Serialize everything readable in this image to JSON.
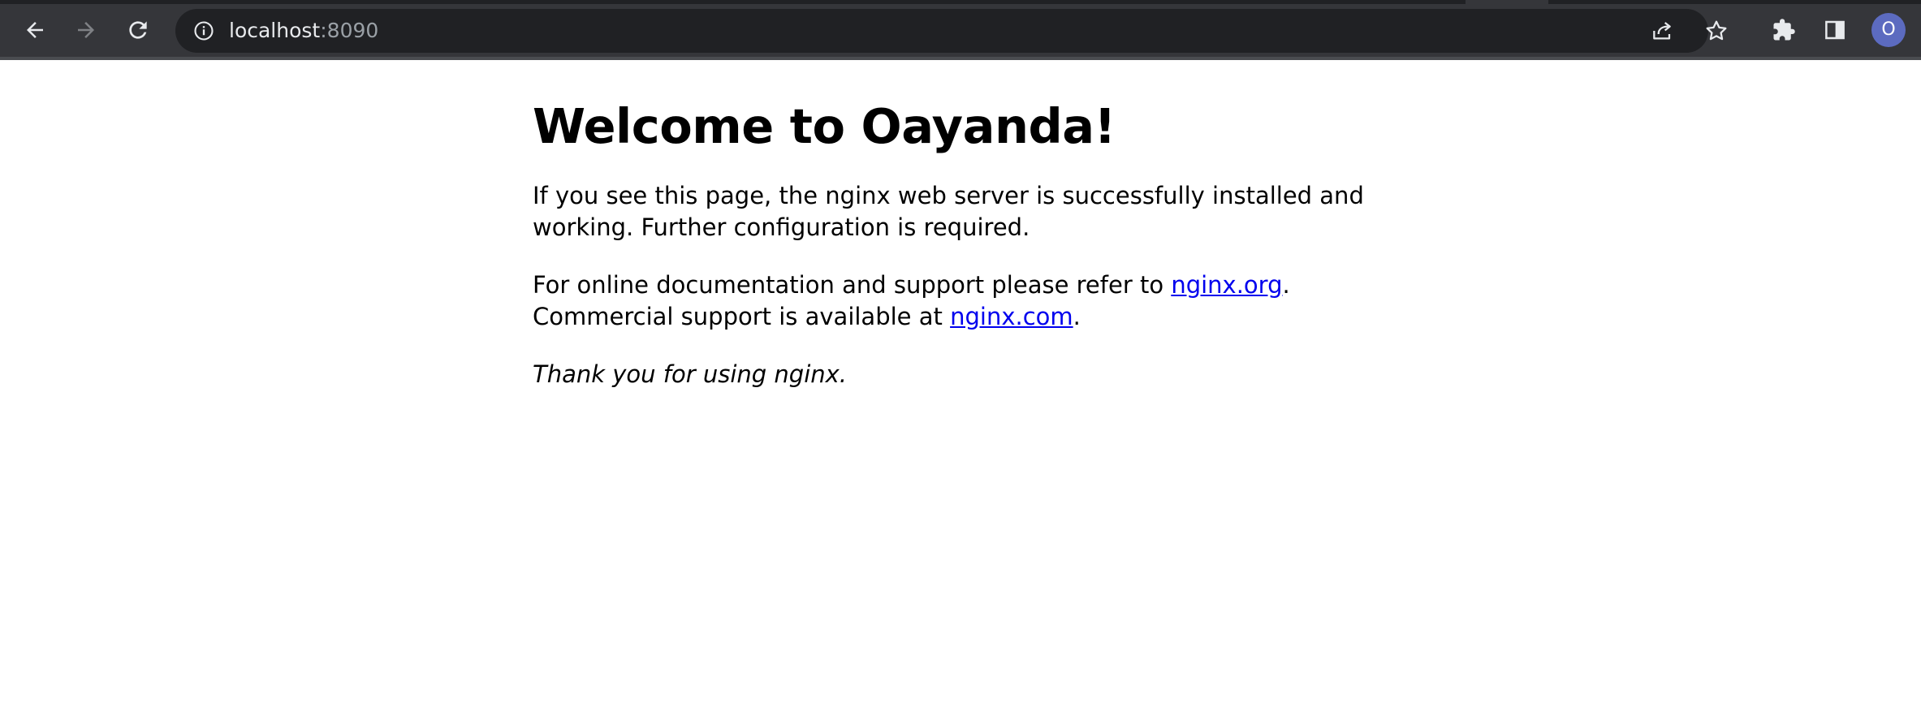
{
  "browser": {
    "url_host": "localhost",
    "url_port": ":8090",
    "avatar_letter": "O",
    "icons": {
      "back": "arrow-left-icon",
      "forward": "arrow-right-icon",
      "reload": "reload-icon",
      "site_info": "info-icon",
      "share": "share-icon",
      "bookmark": "star-icon",
      "extensions": "puzzle-icon",
      "side_panel": "side-panel-icon"
    },
    "colors": {
      "toolbar": "#35363a",
      "omnibox": "#202124",
      "avatar": "#5c6bc0",
      "link": "#0000ee"
    }
  },
  "page": {
    "heading": "Welcome to Oayanda!",
    "para1": "If you see this page, the nginx web server is successfully installed and working. Further configuration is required.",
    "para2_prefix": "For online documentation and support please refer to ",
    "link_org": "nginx.org",
    "para2_mid": ".",
    "para2_line2": "Commercial support is available at ",
    "link_com": "nginx.com",
    "para2_end": ".",
    "para3": "Thank you for using nginx."
  }
}
